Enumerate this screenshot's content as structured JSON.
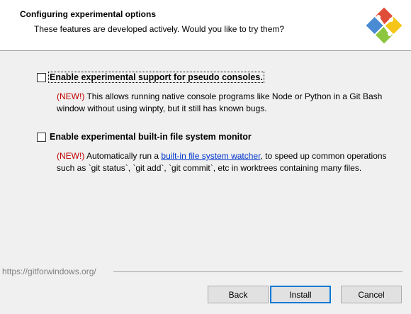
{
  "header": {
    "title": "Configuring experimental options",
    "subtitle": "These features are developed actively. Would you like to try them?",
    "logo_icon": "git-logo-icon",
    "logo_colors": [
      "#e04e39",
      "#4b8bd4",
      "#f5c518",
      "#8cc63f"
    ]
  },
  "options": [
    {
      "label": "Enable experimental support for pseudo consoles.",
      "checked": false,
      "new_tag": "(NEW!)",
      "description": " This allows running native console programs like Node or Python in a Git Bash window without using winpty, but it still has known bugs."
    },
    {
      "label": "Enable experimental built-in file system monitor",
      "checked": false,
      "new_tag": "(NEW!)",
      "description_before": " Automatically run a ",
      "link_text": "built-in file system watcher",
      "description_after": ", to speed up common operations such as `git status`, `git add`, `git commit`, etc in worktrees containing many files."
    }
  ],
  "footer": {
    "url": "https://gitforwindows.org/"
  },
  "buttons": {
    "back": "Back",
    "install": "Install",
    "cancel": "Cancel"
  }
}
